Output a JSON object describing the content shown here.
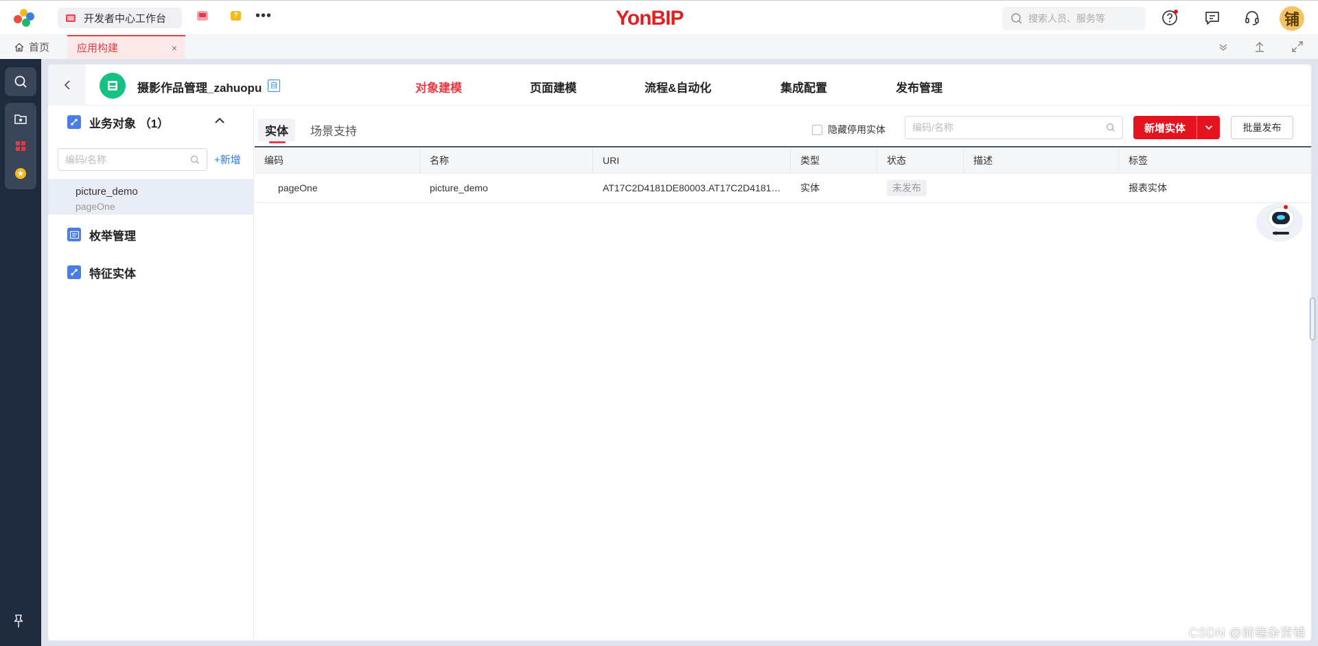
{
  "topbar": {
    "app_chip_label": "开发者中心工作台",
    "brand": "YonBIP",
    "search_placeholder": "搜索人员、服务等",
    "avatar_text": "铺",
    "icons": [
      "help-icon",
      "message-icon",
      "headset-icon"
    ]
  },
  "tabs": {
    "home_label": "首页",
    "active_label": "应用构建",
    "close_glyph": "×"
  },
  "header": {
    "app_name": "摄影作品管理_zahuopu",
    "app_badge": "自",
    "nav": [
      "对象建模",
      "页面建模",
      "流程&自动化",
      "集成配置",
      "发布管理"
    ],
    "active_nav": "对象建模"
  },
  "sidebar": {
    "group1_title": "业务对象 （1）",
    "search_placeholder": "编码/名称",
    "add_label": "新增",
    "selected_item": {
      "name": "picture_demo",
      "code": "pageOne"
    },
    "group2_title": "枚举管理",
    "group3_title": "特征实体"
  },
  "content": {
    "subtabs": [
      "实体",
      "场景支持"
    ],
    "hide_disabled_label": "隐藏停用实体",
    "search_placeholder": "编码/名称",
    "add_entity_label": "新增实体",
    "batch_publish_label": "批量发布",
    "columns": [
      "编码",
      "名称",
      "URI",
      "类型",
      "状态",
      "描述",
      "标签"
    ],
    "rows": [
      {
        "code": "pageOne",
        "name": "picture_demo",
        "uri": "AT17C2D4181DE80003.AT17C2D4181D...",
        "type": "实体",
        "status": "未发布",
        "desc": "",
        "tag": "报表实体"
      }
    ]
  },
  "watermark": "CSDN @前端杂货铺",
  "colors": {
    "accent": "#e5131d",
    "rail": "#1f2b3c",
    "app_icon": "#16c184",
    "link": "#2b7de0"
  }
}
